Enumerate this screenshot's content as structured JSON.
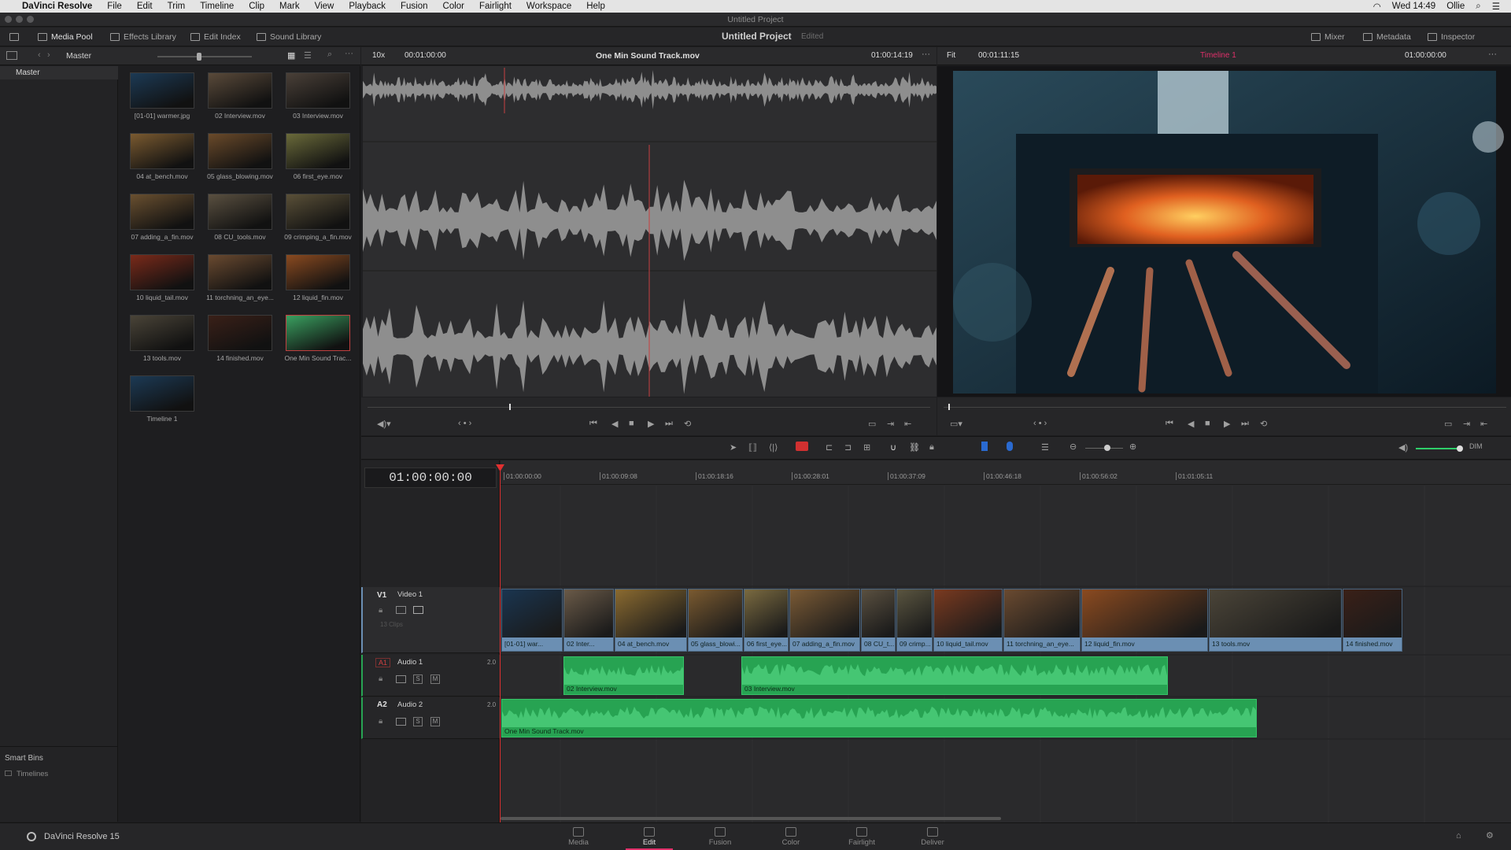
{
  "menubar": {
    "app_name": "DaVinci Resolve",
    "items": [
      "File",
      "Edit",
      "Trim",
      "Timeline",
      "Clip",
      "Mark",
      "View",
      "Playback",
      "Fusion",
      "Color",
      "Fairlight",
      "Workspace",
      "Help"
    ],
    "clock": "Wed 14:49",
    "user": "Ollie"
  },
  "window": {
    "title": "Untitled Project"
  },
  "toolbar": {
    "media_pool": "Media Pool",
    "effects_library": "Effects Library",
    "edit_index": "Edit Index",
    "sound_library": "Sound Library",
    "project_name": "Untitled Project",
    "project_status": "Edited",
    "mixer": "Mixer",
    "metadata": "Metadata",
    "inspector": "Inspector"
  },
  "bins": {
    "current": "Master",
    "master": "Master",
    "smart_bins_title": "Smart Bins",
    "smart_bin_timelines": "Timelines"
  },
  "media_pool": {
    "clips": [
      {
        "name": "[01-01] warmer.jpg",
        "color": "#1c3a55"
      },
      {
        "name": "02 Interview.mov",
        "color": "#5a4a3a"
      },
      {
        "name": "03 Interview.mov",
        "color": "#4a4038"
      },
      {
        "name": "04 at_bench.mov",
        "color": "#7a5a30"
      },
      {
        "name": "05 glass_blowing.mov",
        "color": "#6a4a2a"
      },
      {
        "name": "06 first_eye.mov",
        "color": "#6a6a3a"
      },
      {
        "name": "07 adding_a_fin.mov",
        "color": "#6a5030"
      },
      {
        "name": "08 CU_tools.mov",
        "color": "#5a5040"
      },
      {
        "name": "09 crimping_a_fin.mov",
        "color": "#5a5038"
      },
      {
        "name": "10 liquid_tail.mov",
        "color": "#7a2a1a"
      },
      {
        "name": "11 torchning_an_eye...",
        "color": "#6a4a30"
      },
      {
        "name": "12 liquid_fin.mov",
        "color": "#8a4a20"
      },
      {
        "name": "13 tools.mov",
        "color": "#4a4438"
      },
      {
        "name": "14 finished.mov",
        "color": "#3a2018"
      },
      {
        "name": "One Min Sound Trac...",
        "color": "#3aa060"
      },
      {
        "name": "Timeline 1",
        "color": "#1c3a55"
      }
    ]
  },
  "source_viewer": {
    "zoom": "10x",
    "timecode_in": "00:01:00:00",
    "clip_name": "One Min Sound Track.mov",
    "timecode_out": "01:00:14:19"
  },
  "program_viewer": {
    "fit": "Fit",
    "duration": "00:01:11:15",
    "timeline_name": "Timeline 1",
    "timecode": "01:00:00:00"
  },
  "timeline": {
    "current_timecode": "01:00:00:00",
    "ruler_ticks": [
      "01:00:00:00",
      "01:00:09:08",
      "01:00:18:16",
      "01:00:28:01",
      "01:00:37:09",
      "01:00:46:18",
      "01:00:56:02",
      "01:01:05:11"
    ],
    "tracks": {
      "v1": {
        "id": "V1",
        "name": "Video 1",
        "clip_count": "13 Clips"
      },
      "a1": {
        "id": "A1",
        "name": "Audio 1",
        "level": "2.0"
      },
      "a2": {
        "id": "A2",
        "name": "Audio 2",
        "level": "2.0"
      }
    },
    "video_clips": [
      {
        "name": "[01-01] war...",
        "color": "#1a3550"
      },
      {
        "name": "02 Inter...",
        "color": "#6a5a48"
      },
      {
        "name": "04 at_bench.mov",
        "color": "#8a6a30"
      },
      {
        "name": "05 glass_blowi...",
        "color": "#7a5a30"
      },
      {
        "name": "06 first_eye...",
        "color": "#7a6a40"
      },
      {
        "name": "07 adding_a_fin.mov",
        "color": "#7a5a35"
      },
      {
        "name": "08 CU_t...",
        "color": "#5a5040"
      },
      {
        "name": "09 crimp...",
        "color": "#5a5540"
      },
      {
        "name": "10 liquid_tail.mov",
        "color": "#7a3a20"
      },
      {
        "name": "11 torchning_an_eye...",
        "color": "#6a4a30"
      },
      {
        "name": "12 liquid_fin.mov",
        "color": "#8a4a20"
      },
      {
        "name": "13 tools.mov",
        "color": "#4a4438"
      },
      {
        "name": "14 finished.mov",
        "color": "#3a2018"
      }
    ],
    "audio1_clips": [
      {
        "name": "02 Interview.mov"
      },
      {
        "name": "03 Interview.mov"
      }
    ],
    "audio2_clips": [
      {
        "name": "One Min Sound Track.mov"
      }
    ]
  },
  "pages": [
    "Media",
    "Edit",
    "Fusion",
    "Color",
    "Fairlight",
    "Deliver"
  ],
  "active_page": "Edit",
  "footer": {
    "product": "DaVinci Resolve 15"
  },
  "colors": {
    "accent": "#e0306a",
    "playhead": "#e03030",
    "audio_clip": "#27a352",
    "video_label": "#6b8fb3"
  }
}
